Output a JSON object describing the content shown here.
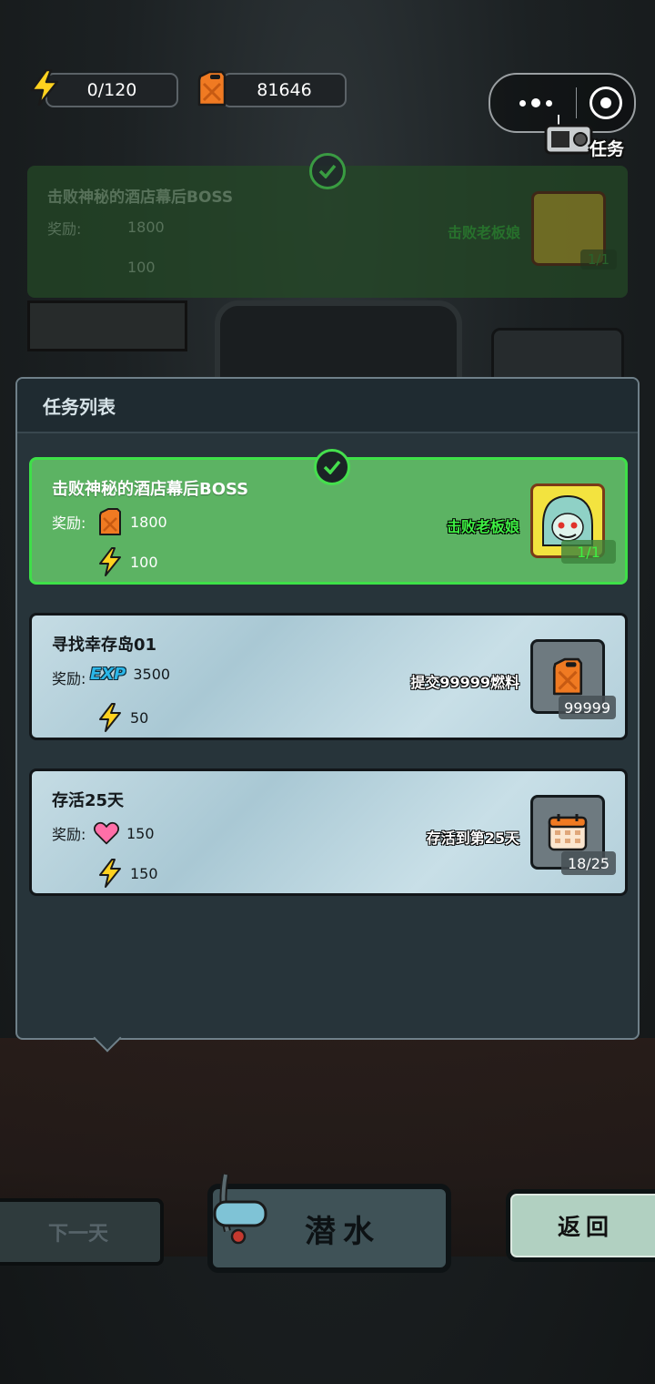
{
  "status": {
    "energy": "0/120",
    "fuel": "81646"
  },
  "task_badge": "任务",
  "background_task": {
    "title": "击败神秘的酒店幕后BOSS",
    "reward_label": "奖励:",
    "rewards": [
      "1800",
      "100"
    ],
    "target": "击败老板娘",
    "progress": "1/1"
  },
  "panel": {
    "title": "任务列表",
    "tasks": [
      {
        "title": "击败神秘的酒店幕后BOSS",
        "reward_label": "奖励:",
        "rewards": [
          {
            "icon": "fuel-can-icon",
            "value": "1800"
          },
          {
            "icon": "lightning-icon",
            "value": "100"
          }
        ],
        "target": "击败老板娘",
        "target_icon": "boss-portrait-icon",
        "progress": "1/1",
        "completed": true
      },
      {
        "title": "寻找幸存岛01",
        "reward_label": "奖励:",
        "rewards": [
          {
            "icon": "exp-icon",
            "label": "EXP",
            "value": "3500"
          },
          {
            "icon": "lightning-icon",
            "value": "50"
          }
        ],
        "target": "提交99999燃料",
        "target_icon": "fuel-can-icon",
        "progress": "99999",
        "completed": false
      },
      {
        "title": "存活25天",
        "reward_label": "奖励:",
        "rewards": [
          {
            "icon": "heart-icon",
            "value": "150"
          },
          {
            "icon": "lightning-icon",
            "value": "150"
          }
        ],
        "target": "存活到第25天",
        "target_icon": "calendar-icon",
        "progress": "18/25",
        "completed": false
      }
    ]
  },
  "buttons": {
    "next_day": "下一天",
    "dive": "潜水",
    "back": "返回"
  },
  "colors": {
    "completed_card": "#5cb363",
    "completed_border": "#3ee048",
    "todo_card": "#b8d3dd",
    "panel": "#27343a"
  }
}
